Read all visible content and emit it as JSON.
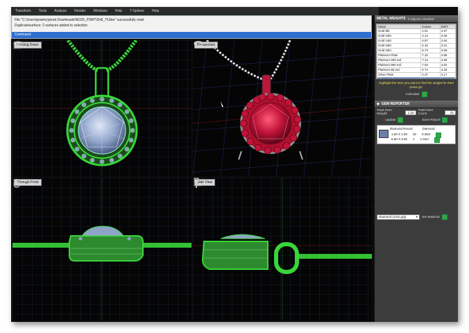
{
  "menu": [
    "Transform",
    "Tools",
    "Analyze",
    "Render",
    "Windows",
    "Help",
    "T-Splines",
    "Help"
  ],
  "command": {
    "lines": [
      "File \"C:\\Users\\jewelry\\pend Downloads\\NO29_P3WT\\Drill_Ti\\Ster\" successfully read",
      "Duplicatesurface: 2 surfaces added to selection"
    ],
    "prompt": "Command:",
    "buttons": [
      "_",
      "□",
      "×"
    ]
  },
  "viewports": {
    "top_left": "Looking Down",
    "top_right": "Perspective",
    "bottom_left": "Through Front",
    "bottom_right": "Side View"
  },
  "metal_weights": {
    "title": "METAL WEIGHTS",
    "subtitle": "3 Objects Checked",
    "columns": [
      "Metal",
      "Grams",
      "DWT"
    ],
    "rows": [
      [
        "Gold 8kt",
        "4.01",
        "2.57"
      ],
      [
        "Gold 10kt",
        "4.14",
        "2.66"
      ],
      [
        "Gold 14kt",
        "4.57",
        "2.94"
      ],
      [
        "Gold 18kt",
        "5.15",
        "3.31"
      ],
      [
        "Gold 22kt",
        "5.73",
        "3.68"
      ],
      [
        "Platinum Plate",
        "7.10",
        "4.56"
      ],
      [
        "Platinum 900 Ind.",
        "7.12",
        "4.58"
      ],
      [
        "Platinum 950 Ind.",
        "7.03",
        "4.52"
      ],
      [
        "Platinum 85 Ind.",
        "6.74",
        "4.33"
      ],
      [
        "Silver Plate",
        "3.37",
        "2.17"
      ],
      [
        "Silver Sterling 2",
        "3.44",
        "2.21"
      ]
    ],
    "selected_row": 10,
    "hint": "Highlight the item you want to find the weight for then press go.",
    "calc_label": "Calculate"
  },
  "gem_reporter": {
    "title": "GEM REPORTER",
    "total_weight_label": "Total Gem Weight",
    "total_weight": "1.32",
    "total_count_label": "Total Gem Count",
    "total_count": "21",
    "update_label": "Update",
    "save_label": "Save Report",
    "list_headers": [
      "Diamond Round",
      "Diamond"
    ],
    "gems": [
      [
        "1.50 X 1.50",
        "20",
        "0.28ct"
      ],
      [
        "6.60 X 6.60",
        "1",
        "1.04ct"
      ]
    ],
    "material_select": "Diamond   (3.52 g/g)",
    "set_material_label": "Set Material"
  },
  "colors": {
    "accent_green": "#39d639",
    "ruby": "#c0143a",
    "command_prompt": "#2f6fd0"
  }
}
